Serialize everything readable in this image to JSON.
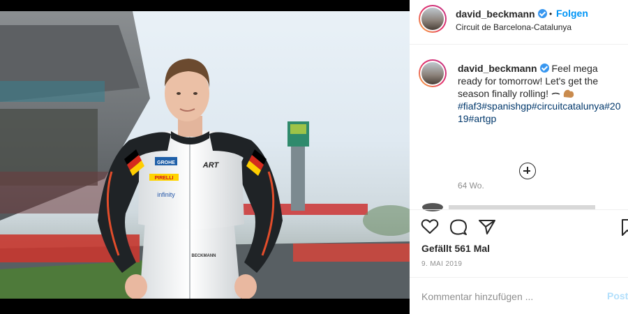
{
  "post": {
    "username": "david_beckmann",
    "follow_label": "Folgen",
    "dot": "•",
    "location": "Circuit de Barcelona-Catalunya"
  },
  "caption": {
    "username": "david_beckmann",
    "text": "Feel mega ready for tomorrow! Let's get the season finally rolling!",
    "hashtags": "#fiaf3#spanishgp#circuitcatalunya#2019#artgp",
    "time_ago": "64 Wo."
  },
  "actions": {
    "likes": "Gefällt 561 Mal",
    "date": "9. MAI 2019"
  },
  "comment": {
    "placeholder": "Kommentar hinzufügen ...",
    "post_label": "Posten"
  },
  "photo": {
    "suit_logos": [
      "GROHE",
      "ART",
      "PIRELLI",
      "infinity",
      "BECKMANN"
    ]
  },
  "colors": {
    "accent": "#0095f6",
    "verified": "#3897f0",
    "hashtag": "#00376b",
    "text": "#262626",
    "muted": "#8e8e8e"
  },
  "icons": [
    "verified-badge-icon",
    "add-comment-icon",
    "heart-icon",
    "comment-icon",
    "share-icon",
    "bookmark-icon",
    "flex-emoji-icon"
  ]
}
